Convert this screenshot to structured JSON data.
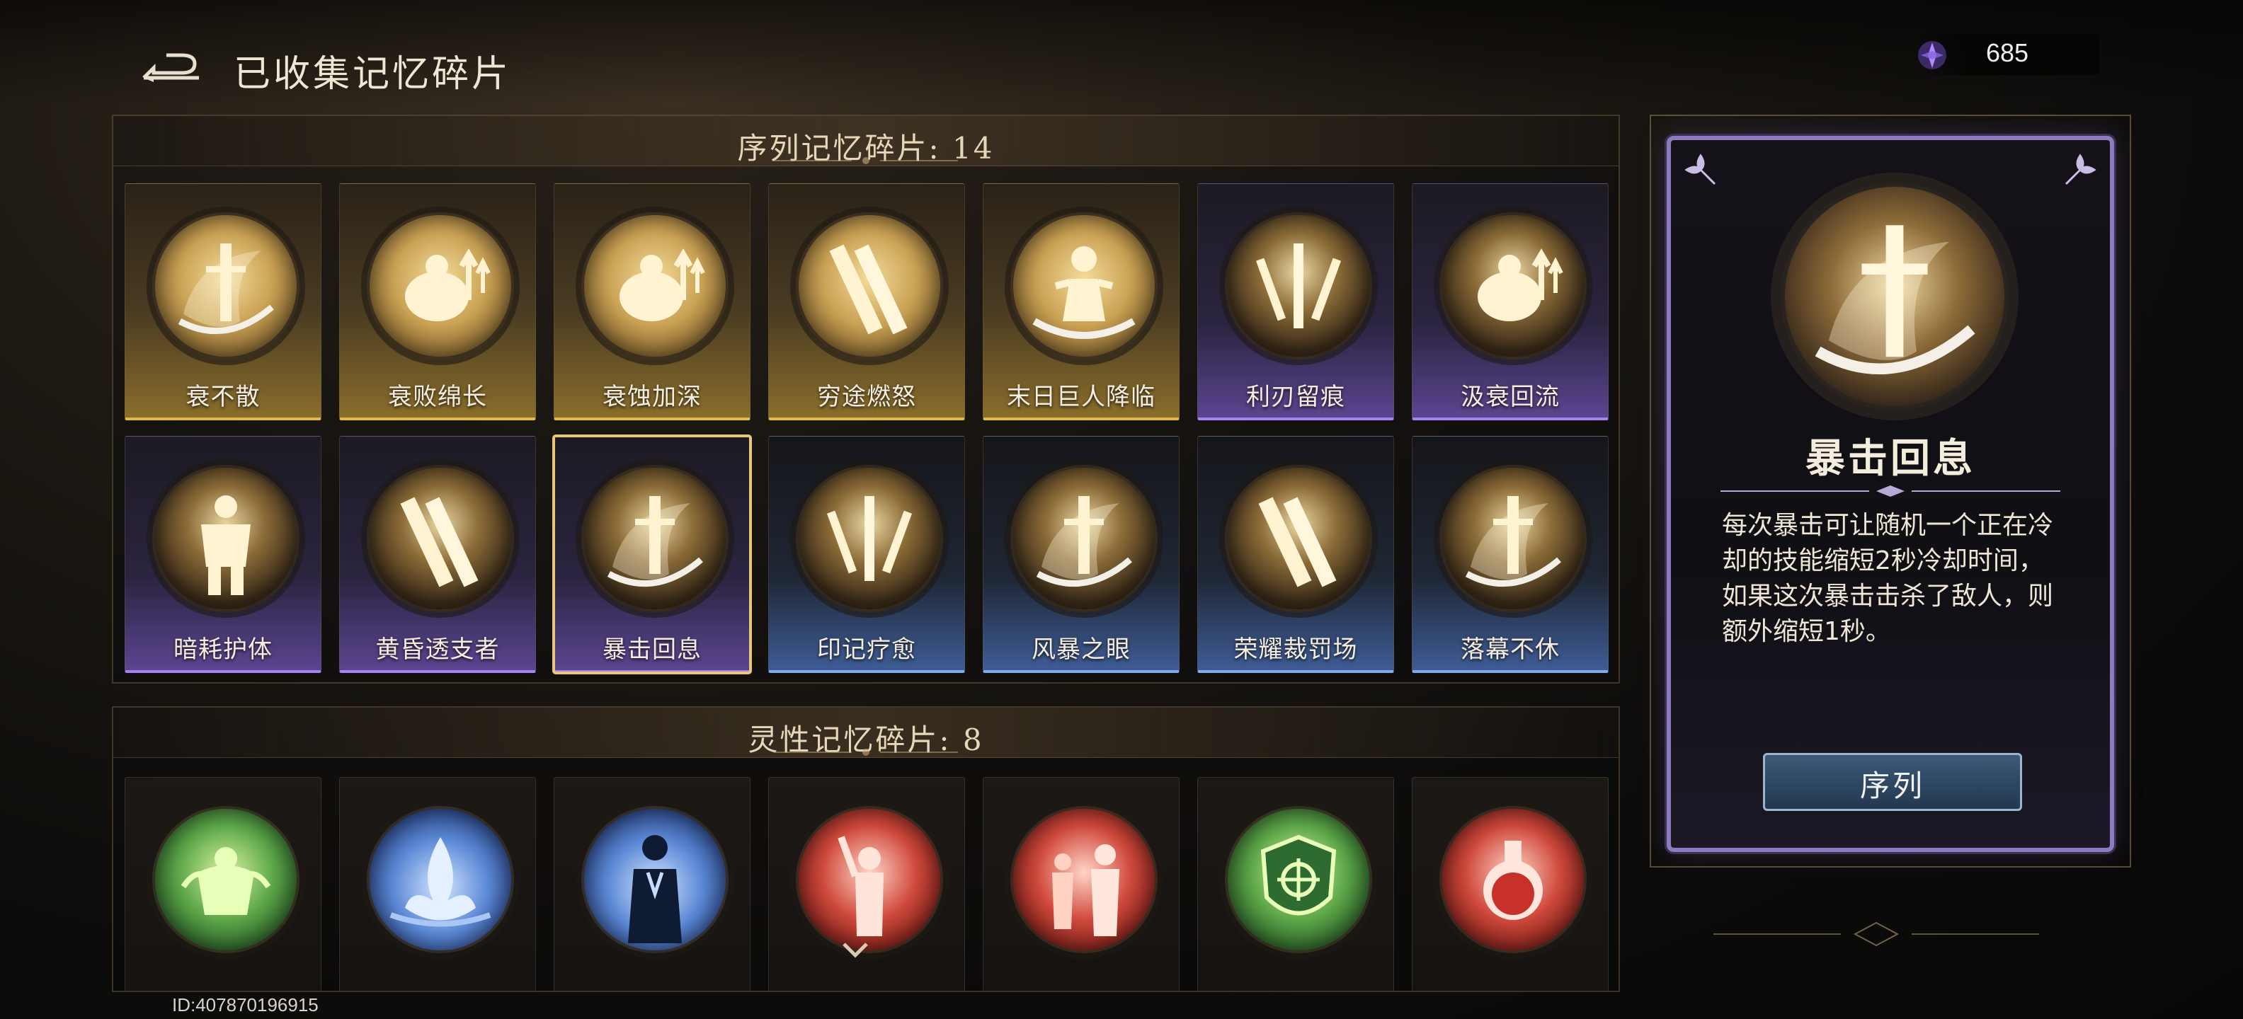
{
  "header": {
    "title": "已收集记忆碎片",
    "currency_value": "685"
  },
  "sequence_section": {
    "title": "序列记忆碎片: 14",
    "cards": [
      {
        "label": "衰不散",
        "rarity": "gold",
        "icon": "sword-swirl-icon"
      },
      {
        "label": "衰败绵长",
        "rarity": "gold",
        "icon": "buff-figure-icon"
      },
      {
        "label": "衰蚀加深",
        "rarity": "gold",
        "icon": "buff-figure-icon"
      },
      {
        "label": "穷途燃怒",
        "rarity": "gold",
        "icon": "crossed-blades-icon"
      },
      {
        "label": "末日巨人降临",
        "rarity": "gold",
        "icon": "giant-figure-icon"
      },
      {
        "label": "利刃留痕",
        "rarity": "purple",
        "icon": "triple-blade-icon"
      },
      {
        "label": "汲衰回流",
        "rarity": "purple",
        "icon": "buff-figure-icon"
      },
      {
        "label": "暗耗护体",
        "rarity": "purple",
        "icon": "armored-figure-icon"
      },
      {
        "label": "黄昏透支者",
        "rarity": "purple",
        "icon": "crossed-blades-icon"
      },
      {
        "label": "暴击回息",
        "rarity": "purple",
        "icon": "sword-swirl-icon"
      },
      {
        "label": "印记疗愈",
        "rarity": "blue",
        "icon": "triple-blade-icon"
      },
      {
        "label": "风暴之眼",
        "rarity": "blue",
        "icon": "sword-swirl-icon"
      },
      {
        "label": "荣耀裁罚场",
        "rarity": "blue",
        "icon": "crossed-blades-icon"
      },
      {
        "label": "落幕不休",
        "rarity": "blue",
        "icon": "sword-swirl-icon"
      }
    ]
  },
  "spirit_section": {
    "title": "灵性记忆碎片: 8",
    "cards": [
      {
        "orb": "green",
        "icon": "green-spirit-icon"
      },
      {
        "orb": "blue",
        "icon": "blue-flame-icon"
      },
      {
        "orb": "blue",
        "icon": "praying-figure-icon"
      },
      {
        "orb": "red",
        "icon": "raised-hand-figure-icon"
      },
      {
        "orb": "red",
        "icon": "twin-figures-icon"
      },
      {
        "orb": "green",
        "icon": "shield-emblem-icon"
      },
      {
        "orb": "red",
        "icon": "potion-flask-icon"
      }
    ]
  },
  "detail": {
    "title": "暴击回息",
    "description": "每次暴击可让随机一个正在冷却的技能缩短2秒冷却时间，如果这次暴击击杀了敌人，则额外缩短1秒。",
    "category": "序列"
  },
  "footer": {
    "player_id": "ID:407870196915"
  },
  "colors": {
    "gold": "#e3b84a",
    "purple": "#a683f0",
    "blue": "#82a9ee",
    "selected_border": "#e8c878"
  }
}
